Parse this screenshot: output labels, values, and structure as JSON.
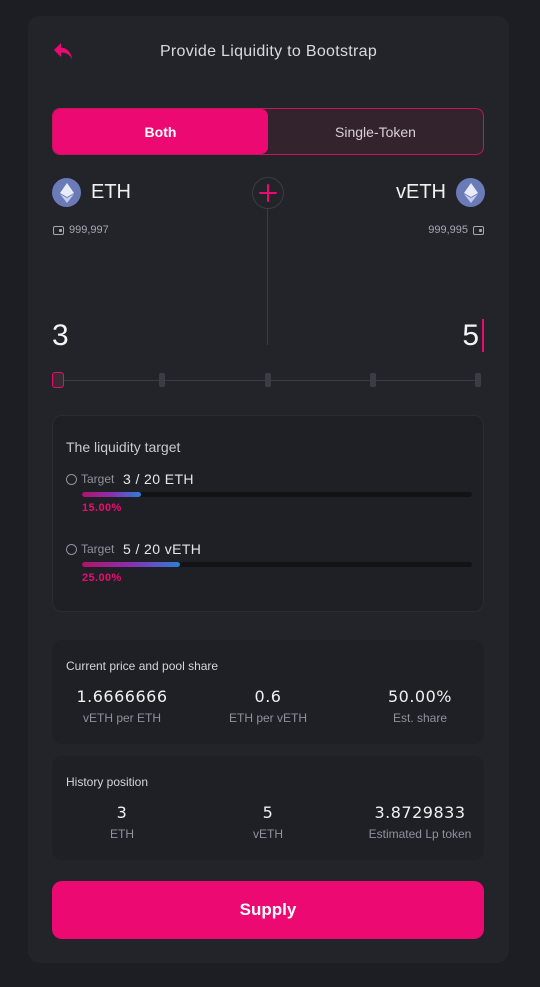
{
  "header": {
    "title": "Provide Liquidity to Bootstrap"
  },
  "mode": {
    "tabs": [
      {
        "label": "Both",
        "active": true
      },
      {
        "label": "Single-Token",
        "active": false
      }
    ]
  },
  "tokens": {
    "left": {
      "symbol": "ETH",
      "balance": "999,997",
      "amount": "3",
      "icon": "ethereum-icon"
    },
    "right": {
      "symbol": "vETH",
      "balance": "999,995",
      "amount": "5",
      "icon": "ethereum-icon"
    }
  },
  "slider": {
    "value_fraction": 0,
    "steps": 5
  },
  "target": {
    "heading": "The liquidity target",
    "rows": [
      {
        "label": "Target",
        "value": "3 / 20 ETH",
        "percent": "15.00%",
        "fraction": 0.15
      },
      {
        "label": "Target",
        "value": "5 / 20 vETH",
        "percent": "25.00%",
        "fraction": 0.25
      }
    ]
  },
  "price": {
    "heading": "Current price and pool share",
    "cols": [
      {
        "value": "1.6666666",
        "label": "vETH per ETH"
      },
      {
        "value": "0.6",
        "label": "ETH per vETH"
      },
      {
        "value": "50.00%",
        "label": "Est. share"
      }
    ]
  },
  "history": {
    "heading": "History position",
    "cols": [
      {
        "value": "3",
        "label": "ETH"
      },
      {
        "value": "5",
        "label": "vETH"
      },
      {
        "value": "3.8729833",
        "label": "Estimated Lp token"
      }
    ]
  },
  "supply": {
    "label": "Supply"
  },
  "colors": {
    "accent": "#ec0a72",
    "background": "#1c1e23",
    "card": "#22242a"
  }
}
